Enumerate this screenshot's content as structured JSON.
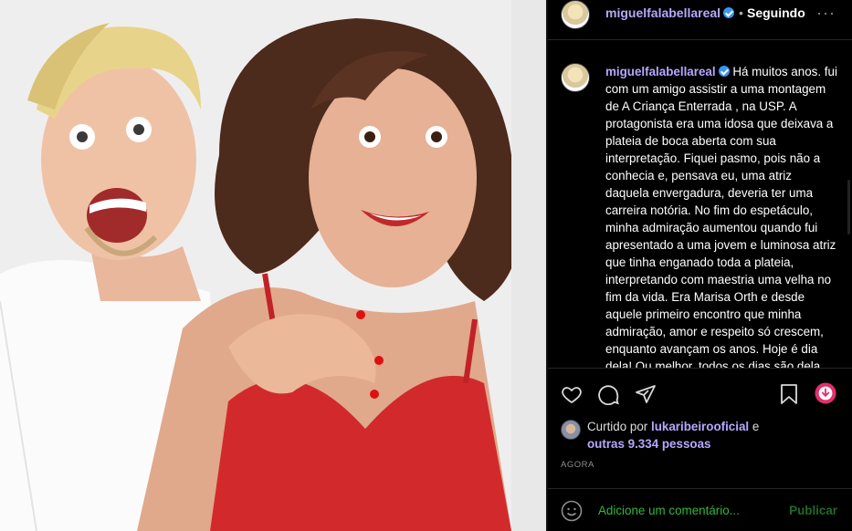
{
  "post": {
    "username": "miguelfalabellareal",
    "dot": "•",
    "following": "Seguindo",
    "more": "···"
  },
  "caption": {
    "username": "miguelfalabellareal",
    "text": "Há muitos anos. fui com um amigo assistir a uma montagem de A Criança Enterrada , na USP. A protagonista era uma idosa que deixava a plateia de boca aberta com sua interpretação. Fiquei pasmo, pois não a conhecia e, pensava eu, uma atriz daquela envergadura, deveria ter uma carreira notória. No fim do espetáculo, minha admiração aumentou quando fui apresentado a uma jovem e luminosa atriz que tinha enganado toda a plateia, interpretando com maestria uma velha no fim da vida. Era Marisa Orth e desde aquele primeiro encontro que minha admiração, amor e respeito só crescem, enquanto avançam os anos. Hoje é dia dela! Ou melhor, todos os dias são dela,"
  },
  "likes": {
    "prefix": "Curtido por",
    "user": "lukaribeirooficial",
    "and": "e",
    "others": "outras 9.334 pessoas"
  },
  "time": "AGORA",
  "comment": {
    "placeholder": "Adicione um comentário...",
    "publish": "Publicar"
  },
  "icons": [
    "heart-icon",
    "comment-icon",
    "share-icon",
    "bookmark-icon",
    "download-icon",
    "smile-icon",
    "verified-icon"
  ],
  "colors": {
    "username": "#b7a7ff",
    "verified": "#3897f0",
    "comment_placeholder": "#35b53f",
    "publish": "#1f6b25",
    "download_badge": "#e1306c"
  }
}
